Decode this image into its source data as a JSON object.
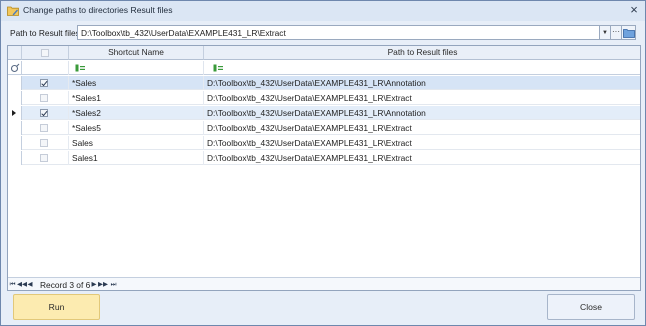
{
  "window": {
    "title": "Change paths to directories Result files",
    "close_symbol": "×"
  },
  "path_bar": {
    "label": "Path to Result files:",
    "value": "D:\\Toolbox\\tb_432\\UserData\\EXAMPLE431_LR\\Extract",
    "dropdown_symbol": "▼",
    "browse_symbol": "···"
  },
  "grid": {
    "columns": {
      "shortcut_name": "Shortcut Name",
      "path": "Path to Result files"
    },
    "rows": [
      {
        "checked": true,
        "name": "*Sales",
        "path": "D:\\Toolbox\\tb_432\\UserData\\EXAMPLE431_LR\\Annotation"
      },
      {
        "checked": false,
        "name": "*Sales1",
        "path": "D:\\Toolbox\\tb_432\\UserData\\EXAMPLE431_LR\\Extract"
      },
      {
        "checked": true,
        "name": "*Sales2",
        "path": "D:\\Toolbox\\tb_432\\UserData\\EXAMPLE431_LR\\Annotation"
      },
      {
        "checked": false,
        "name": "*Sales5",
        "path": "D:\\Toolbox\\tb_432\\UserData\\EXAMPLE431_LR\\Extract"
      },
      {
        "checked": false,
        "name": "Sales",
        "path": "D:\\Toolbox\\tb_432\\UserData\\EXAMPLE431_LR\\Extract"
      },
      {
        "checked": false,
        "name": "Sales1",
        "path": "D:\\Toolbox\\tb_432\\UserData\\EXAMPLE431_LR\\Extract"
      }
    ],
    "navigator": {
      "record_text": "Record 3 of 6"
    }
  },
  "buttons": {
    "run": "Run",
    "close": "Close"
  },
  "colors": {
    "window_background": "#e7eef8",
    "highlight_row": "#d6e4f6",
    "run_button": "#fcebb0",
    "filter_icon_green": "#3a9a3a"
  }
}
